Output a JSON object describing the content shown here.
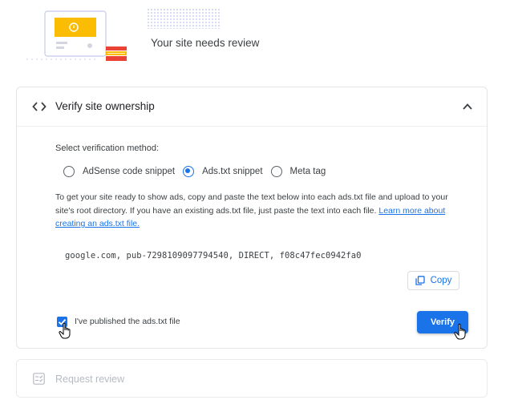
{
  "header": {
    "title": "Your site needs review"
  },
  "verify_section": {
    "title": "Verify site ownership",
    "method_label": "Select verification method:",
    "methods": [
      {
        "label": "AdSense code snippet",
        "selected": false
      },
      {
        "label": "Ads.txt snippet",
        "selected": true
      },
      {
        "label": "Meta tag",
        "selected": false
      }
    ],
    "description": "To get your site ready to show ads, copy and paste the text below into each ads.txt file and upload to your site's root directory. If you have an existing ads.txt file, just paste the text into each file.",
    "learn_more_link": "Learn more about creating an ads.txt file.",
    "snippet": "google.com, pub-7298109097794540, DIRECT, f08c47fec0942fa0",
    "copy_label": "Copy",
    "checkbox_label": "I've published the ads.txt file",
    "checkbox_checked": true,
    "verify_label": "Verify"
  },
  "request_review": {
    "label": "Request review"
  },
  "colors": {
    "accent": "#1a73e8",
    "disabled_text": "#b6bbc2"
  }
}
